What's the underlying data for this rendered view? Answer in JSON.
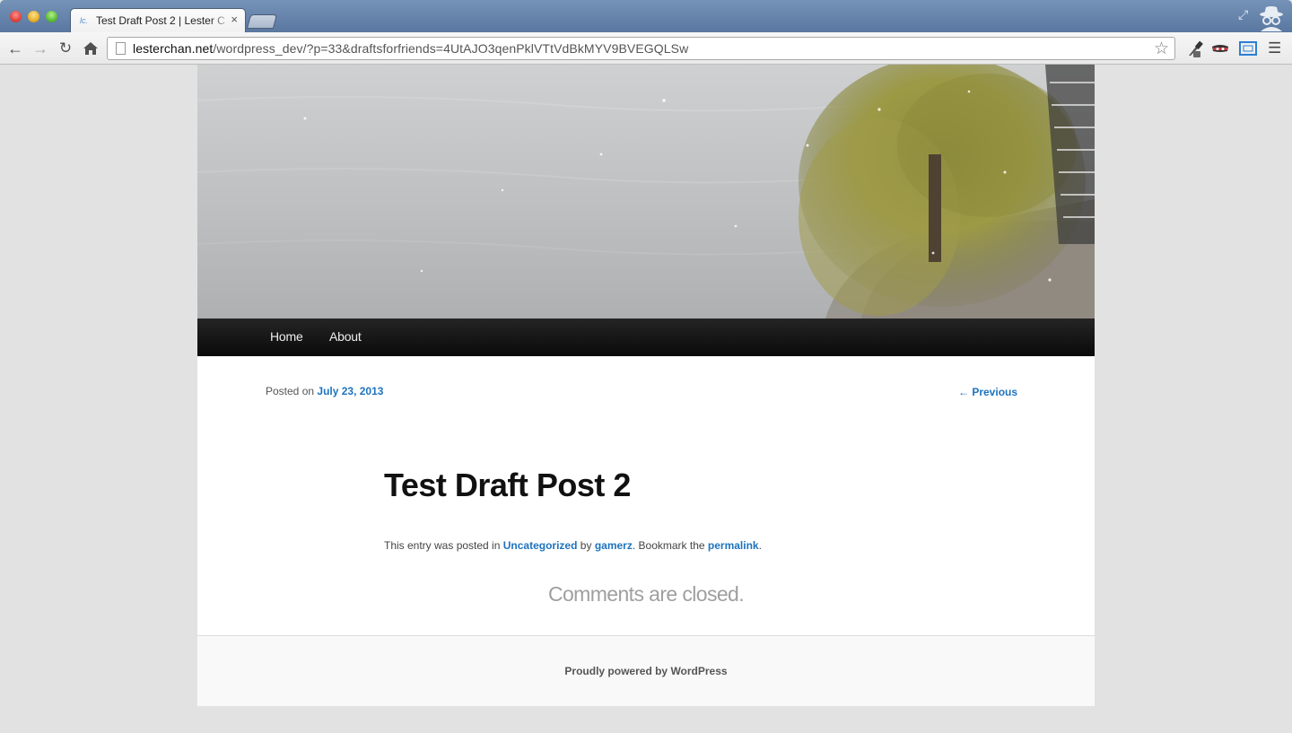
{
  "browser": {
    "tab": {
      "favicon": "lc.",
      "title": "Test Draft Post 2 | Lester C",
      "close": "×"
    },
    "toolbar": {
      "url_host": "lesterchan.net",
      "url_path": "/wordpress_dev/?p=33&draftsforfriends=4UtAJO3qenPklVTtVdBkMYV9BVEGQLSw",
      "icons": [
        "back-icon",
        "forward-icon",
        "reload-icon",
        "home-icon",
        "page-icon",
        "bookmark-star-icon",
        "eyedropper-icon",
        "mask-icon",
        "screen-icon",
        "menu-icon"
      ]
    }
  },
  "site": {
    "nav": [
      {
        "label": "Home"
      },
      {
        "label": "About"
      }
    ],
    "post": {
      "posted_on_prefix": "Posted on",
      "date": "July 23, 2013",
      "previous": "← Previous",
      "title": "Test Draft Post 2",
      "meta_prefix": "This entry was posted in",
      "category": "Uncategorized",
      "by": "by",
      "author": "gamerz",
      "bookmark_text": ". Bookmark the",
      "permalink": "permalink",
      "period": "."
    },
    "comments_closed": "Comments are closed.",
    "footer": "Proudly powered by WordPress"
  }
}
